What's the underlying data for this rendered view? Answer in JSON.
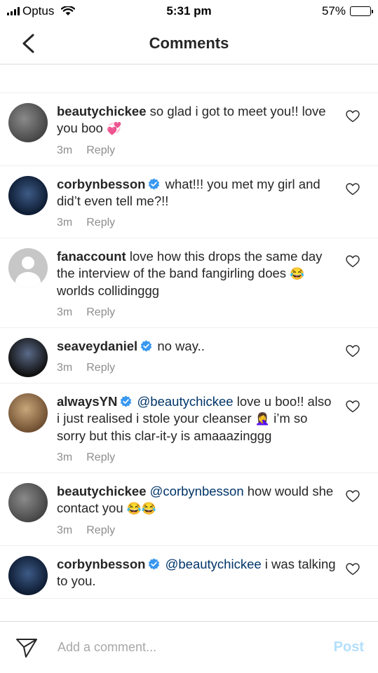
{
  "status": {
    "carrier": "Optus",
    "time": "5:31 pm",
    "battery": "57%",
    "battery_level": 0.57
  },
  "header": {
    "title": "Comments"
  },
  "comments": [
    {
      "user": "beautychickee",
      "verified": false,
      "avatar": "av-photo",
      "parts": [
        {
          "t": "so glad i got to meet you!! love you boo "
        },
        {
          "e": "💞"
        }
      ],
      "time": "3m",
      "reply": "Reply"
    },
    {
      "user": "corbynbesson",
      "verified": true,
      "avatar": "av-dark",
      "parts": [
        {
          "t": "what!!! you met my girl and did’t even tell me?!!"
        }
      ],
      "time": "3m",
      "reply": "Reply"
    },
    {
      "user": "fanaccount",
      "verified": false,
      "avatar": "av-blank",
      "parts": [
        {
          "t": "love how this drops the same day the interview of the band fangirling does "
        },
        {
          "e": "😂"
        },
        {
          "t": " worlds collidinggg"
        }
      ],
      "time": "3m",
      "reply": "Reply"
    },
    {
      "user": "seaveydaniel",
      "verified": true,
      "avatar": "av-night",
      "parts": [
        {
          "t": "no way.."
        }
      ],
      "time": "3m",
      "reply": "Reply"
    },
    {
      "user": "alwaysYN",
      "verified": true,
      "avatar": "av-beige",
      "parts": [
        {
          "m": "@beautychickee"
        },
        {
          "t": " love u boo!! also i just realised i stole your cleanser "
        },
        {
          "e": "🤦‍♀️"
        },
        {
          "t": " i’m so sorry but this clar-it-y is amaaazinggg"
        }
      ],
      "time": "3m",
      "reply": "Reply"
    },
    {
      "user": "beautychickee",
      "verified": false,
      "avatar": "av-photo",
      "parts": [
        {
          "m": "@corbynbesson"
        },
        {
          "t": " how would she contact you "
        },
        {
          "e": "😂😂"
        }
      ],
      "time": "3m",
      "reply": "Reply"
    },
    {
      "user": "corbynbesson",
      "verified": true,
      "avatar": "av-dark",
      "parts": [
        {
          "m": "@beautychickee"
        },
        {
          "t": " i was talking to you."
        }
      ],
      "time": "",
      "reply": ""
    }
  ],
  "composer": {
    "placeholder": "Add a comment...",
    "post_label": "Post"
  },
  "colors": {
    "mention": "#003569",
    "verified": "#3897f0",
    "post_disabled": "#b2dffc",
    "meta": "#8e8e8e"
  }
}
